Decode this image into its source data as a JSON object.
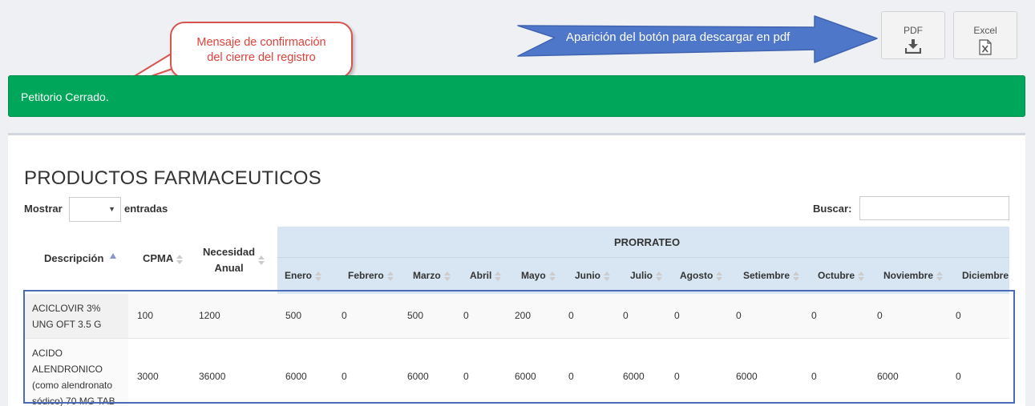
{
  "annotations": {
    "callout_text_1": "Mensaje de confirmación",
    "callout_text_2": "del cierre del registro",
    "arrow_text": "Aparición del botón para descargar en pdf"
  },
  "toolbar": {
    "pdf_label": "PDF",
    "excel_label": "Excel"
  },
  "alert": {
    "message": "Petitorio Cerrado."
  },
  "panel": {
    "title": "PRODUCTOS FARMACEUTICOS",
    "show_label": "Mostrar",
    "entries_label": "entradas",
    "show_value": "",
    "search_label": "Buscar:",
    "search_value": ""
  },
  "table": {
    "headers": {
      "descripcion": "Descripción",
      "cpma": "CPMA",
      "necesidad_1": "Necesidad",
      "necesidad_2": "Anual",
      "prorrateo": "PRORRATEO"
    },
    "months": [
      "Enero",
      "Febrero",
      "Marzo",
      "Abril",
      "Mayo",
      "Junio",
      "Julio",
      "Agosto",
      "Setiembre",
      "Octubre",
      "Noviembre",
      "Diciembre"
    ],
    "rows": [
      {
        "desc_lines": [
          "ACICLOVIR 3%",
          "UNG OFT 3.5 G"
        ],
        "cpma": "100",
        "necesidad": "1200",
        "months": [
          "500",
          "0",
          "500",
          "0",
          "200",
          "0",
          "0",
          "0",
          "0",
          "0",
          "0",
          "0"
        ]
      },
      {
        "desc_lines": [
          "ACIDO",
          "ALENDRONICO",
          "(como alendronato",
          "sódico) 70 MG TAB"
        ],
        "cpma": "3000",
        "necesidad": "36000",
        "months": [
          "6000",
          "0",
          "6000",
          "0",
          "6000",
          "0",
          "6000",
          "0",
          "6000",
          "0",
          "6000",
          "0"
        ]
      }
    ]
  },
  "colors": {
    "alert_green": "#00a65a",
    "header_band": "#d7e6f2",
    "arrow_blue": "#4f77c9",
    "highlight_border": "#4a6bb8",
    "callout_border": "#d9534f"
  }
}
